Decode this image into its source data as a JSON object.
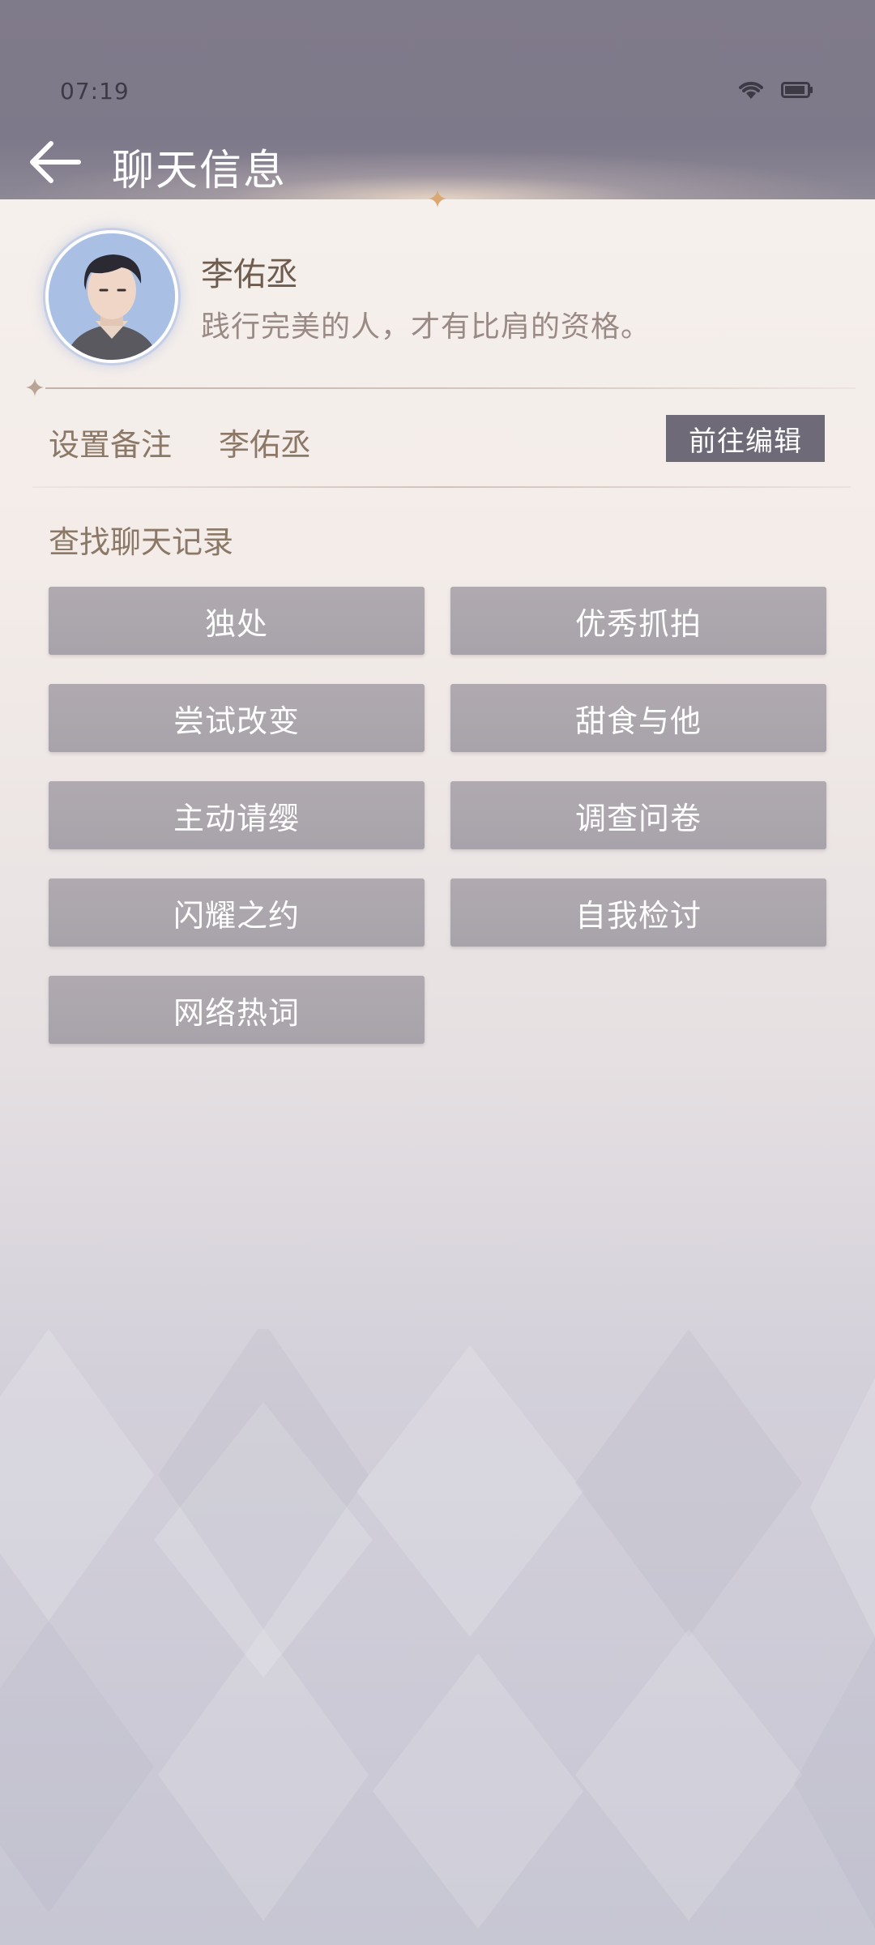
{
  "status_bar": {
    "time": "07:19",
    "icons": [
      "wifi-icon",
      "battery-icon"
    ]
  },
  "header": {
    "back_icon": "arrow-left-icon",
    "title": "聊天信息"
  },
  "profile": {
    "name": "李佑丞",
    "bio": "践行完美的人，才有比肩的资格。"
  },
  "remark": {
    "label": "设置备注",
    "value": "李佑丞",
    "edit_button": "前往编辑"
  },
  "search": {
    "title": "查找聊天记录",
    "items": [
      {
        "label": "独处"
      },
      {
        "label": "优秀抓拍"
      },
      {
        "label": "尝试改变"
      },
      {
        "label": "甜食与他"
      },
      {
        "label": "主动请缨"
      },
      {
        "label": "调查问卷"
      },
      {
        "label": "闪耀之约"
      },
      {
        "label": "自我检讨"
      },
      {
        "label": "网络热词"
      }
    ]
  },
  "colors": {
    "header_bg": "#807b8b",
    "accent_text": "#8b7866",
    "button_bg": "#aca6ad",
    "edit_button_bg": "#6e6a78"
  }
}
